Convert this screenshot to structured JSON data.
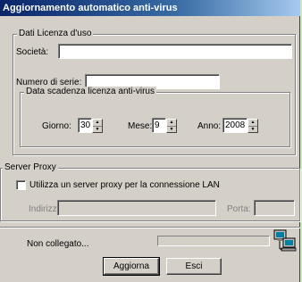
{
  "window": {
    "title": "Aggiornamento automatico anti-virus"
  },
  "license": {
    "legend": "Dati Licenza d'uso",
    "company_label": "Società:",
    "company_value": "",
    "serial_label": "Numero di serie:",
    "serial_value": "",
    "expiry": {
      "legend": "Data scadenza licenza anti-virus",
      "day_label": "Giorno:",
      "day_value": "30",
      "month_label": "Mese:",
      "month_value": "9",
      "year_label": "Anno:",
      "year_value": "2008"
    }
  },
  "proxy": {
    "legend": "Server Proxy",
    "use_proxy_label": "Utilizza un server proxy per la connessione LAN",
    "use_proxy_checked": false,
    "address_label": "Indirizzo:",
    "address_value": "",
    "port_label": "Porta:",
    "port_value": ""
  },
  "status": {
    "text": "Non collegato...",
    "progress_percent": 0
  },
  "buttons": {
    "update_label": "Aggiorna",
    "exit_label": "Esci"
  },
  "icons": {
    "spin_up": "spin-up-arrow",
    "spin_down": "spin-down-arrow",
    "network": "network-computers-icon"
  },
  "colors": {
    "titlebar_start": "#0a246a",
    "titlebar_end": "#a6caf0",
    "window_bg": "#d4d0c8",
    "desktop_bg": "#cfe6c4"
  }
}
